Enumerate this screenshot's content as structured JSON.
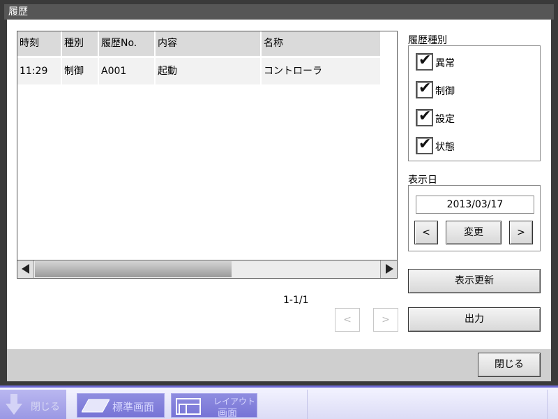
{
  "window": {
    "title": "履歴"
  },
  "table": {
    "headers": [
      "時刻",
      "種別",
      "履歴No.",
      "内容",
      "名称"
    ],
    "rows": [
      [
        "11:29",
        "制御",
        "A001",
        "起動",
        "コントローラ"
      ]
    ]
  },
  "paging": {
    "indicator": "1-1/1",
    "prev_label": "<",
    "next_label": ">"
  },
  "filter": {
    "title": "履歴種別",
    "items": [
      {
        "label": "異常",
        "checked": true
      },
      {
        "label": "制御",
        "checked": true
      },
      {
        "label": "設定",
        "checked": true
      },
      {
        "label": "状態",
        "checked": true
      }
    ]
  },
  "date": {
    "title": "表示日",
    "value": "2013/03/17",
    "prev_label": "<",
    "change_label": "変更",
    "next_label": ">"
  },
  "buttons": {
    "refresh": "表示更新",
    "output": "出力",
    "close": "閉じる"
  },
  "taskbar": {
    "close_label": "閉じる",
    "standard_label": "標準画面",
    "layout_label_1": "レイアウト",
    "layout_label_2": "画面"
  },
  "colors": {
    "accent": "#6e6ad4",
    "frame": "#3a3a3a",
    "titlebar": "#565656"
  }
}
